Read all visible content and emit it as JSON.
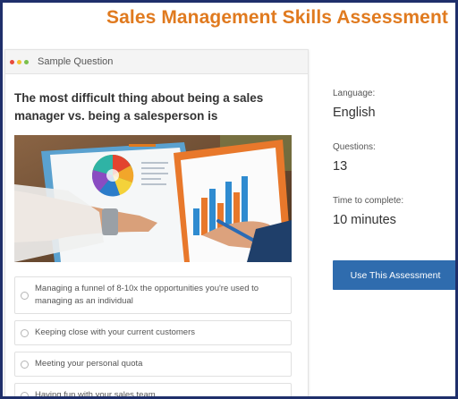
{
  "page": {
    "title": "Sales Management Skills Assessment"
  },
  "card": {
    "header_label": "Sample Question",
    "question": "The most difficult thing about being a sales manager vs. being a salesperson is",
    "options": [
      "Managing a funnel of 8-10x the opportunities you're used to managing as an individual",
      "Keeping close with your current customers",
      "Meeting your personal quota",
      "Having fun with your sales team"
    ]
  },
  "details": {
    "language_label": "Language:",
    "language_value": "English",
    "questions_label": "Questions:",
    "questions_value": "13",
    "time_label": "Time to complete:",
    "time_value": "10 minutes"
  },
  "cta": {
    "label": "Use This Assessment"
  },
  "colors": {
    "title": "#e07a1f",
    "button": "#2f6cae",
    "frame": "#1f2f6b"
  }
}
